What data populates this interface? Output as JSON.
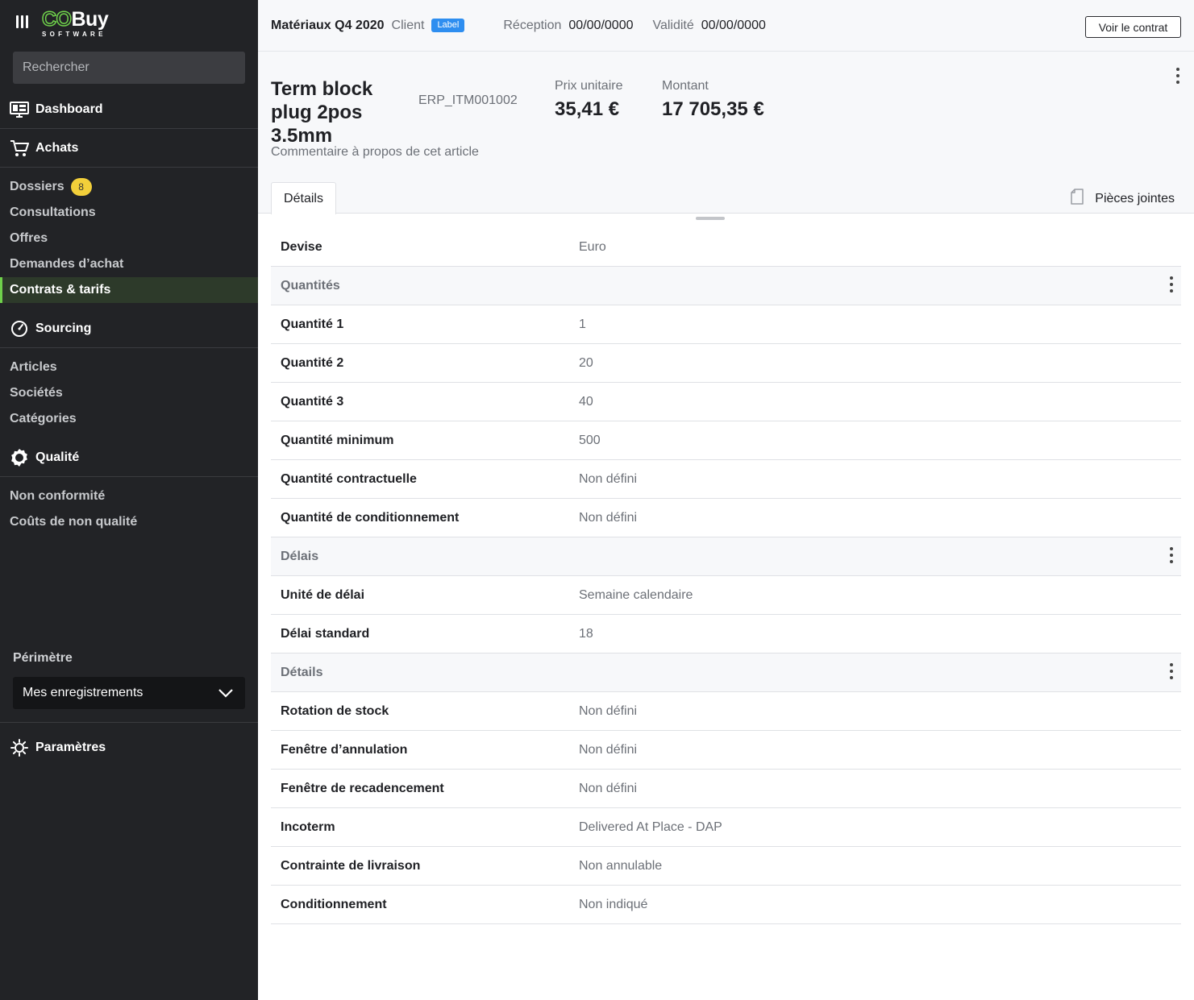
{
  "brand": {
    "co": "CO",
    "buy": "Buy",
    "sub": "SOFTWARE"
  },
  "sidebar": {
    "search_placeholder": "Rechercher",
    "dashboard": "Dashboard",
    "achats": "Achats",
    "achats_items": [
      {
        "label": "Dossiers",
        "badge": "8"
      },
      {
        "label": "Consultations"
      },
      {
        "label": "Offres"
      },
      {
        "label": "Demandes d’achat"
      },
      {
        "label": "Contrats & tarifs",
        "active": true
      }
    ],
    "sourcing": "Sourcing",
    "sourcing_items": [
      "Articles",
      "Sociétés",
      "Catégories"
    ],
    "qualite": "Qualité",
    "qualite_items": [
      "Non conformité",
      "Coûts de non qualité"
    ],
    "perimetre_label": "Périmètre",
    "perimetre_value": "Mes enregistrements",
    "parametres": "Paramètres"
  },
  "topbar": {
    "title": "Matériaux Q4 2020",
    "client_label": "Client",
    "tag": "Label",
    "reception_label": "Réception",
    "reception_value": "00/00/0000",
    "validite_label": "Validité",
    "validite_value": "00/00/0000",
    "contract_button": "Voir le contrat"
  },
  "item": {
    "name": "Term block plug 2pos 3.5mm",
    "ref": "ERP_ITM001002",
    "unit_price_label": "Prix unitaire",
    "unit_price": "35,41 €",
    "amount_label": "Montant",
    "amount": "17 705,35 €",
    "comment": "Commentaire à propos de cet article"
  },
  "tabs": {
    "details": "Détails",
    "attachments": "Pièces jointes"
  },
  "rows": {
    "devise": {
      "k": "Devise",
      "v": "Euro"
    },
    "sec_quantites": "Quantités",
    "q1": {
      "k": "Quantité 1",
      "v": "1"
    },
    "q2": {
      "k": "Quantité 2",
      "v": "20"
    },
    "q3": {
      "k": "Quantité 3",
      "v": "40"
    },
    "qmin": {
      "k": "Quantité minimum",
      "v": "500"
    },
    "qcontract": {
      "k": "Quantité contractuelle",
      "v": "Non défini"
    },
    "qcond": {
      "k": "Quantité de conditionnement",
      "v": "Non défini"
    },
    "sec_delais": "Délais",
    "unite_delai": {
      "k": "Unité de délai",
      "v": "Semaine calendaire"
    },
    "delai_std": {
      "k": "Délai standard",
      "v": "18"
    },
    "sec_details": "Détails",
    "rotation": {
      "k": "Rotation de stock",
      "v": "Non défini"
    },
    "annulation": {
      "k": "Fenêtre d’annulation",
      "v": "Non défini"
    },
    "recadencement": {
      "k": "Fenêtre de recadencement",
      "v": "Non défini"
    },
    "incoterm": {
      "k": "Incoterm",
      "v": "Delivered At Place - DAP"
    },
    "contrainte": {
      "k": "Contrainte de livraison",
      "v": "Non annulable"
    },
    "conditionnement": {
      "k": "Conditionnement",
      "v": "Non indiqué"
    }
  },
  "colors": {
    "accent": "#6fd14b",
    "badge": "#f2cf3a",
    "tag": "#2e8ef0",
    "sidebar": "#222326"
  }
}
